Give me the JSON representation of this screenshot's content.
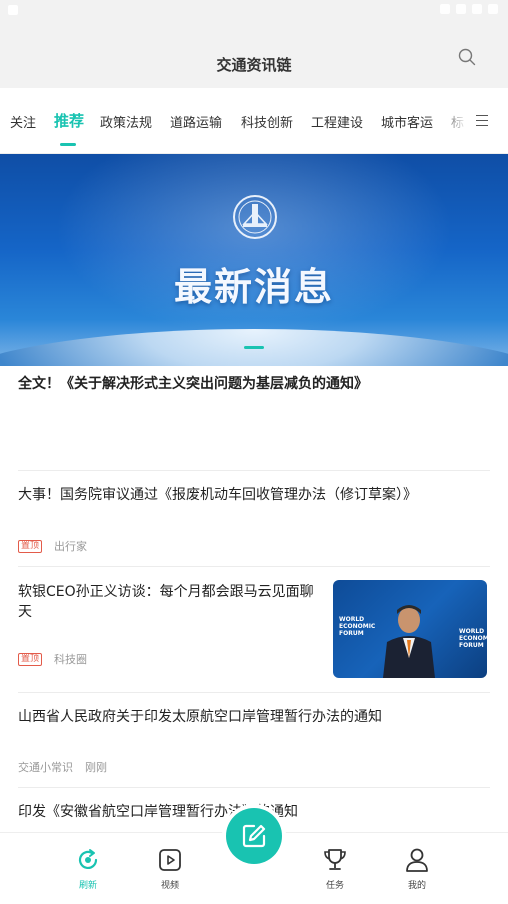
{
  "app": {
    "title": "交通资讯链"
  },
  "tabs": [
    {
      "label": "关注"
    },
    {
      "label": "推荐",
      "active": true
    },
    {
      "label": "政策法规"
    },
    {
      "label": "道路运输"
    },
    {
      "label": "科技创新"
    },
    {
      "label": "工程建设"
    },
    {
      "label": "城市客运"
    },
    {
      "label": "标"
    }
  ],
  "banner": {
    "title": "最新消息"
  },
  "articles": [
    {
      "title": "全文！《关于解决形式主义突出问题为基层减负的通知》"
    },
    {
      "title": "大事！国务院审议通过《报废机动车回收管理办法（修订草案）》",
      "tag": "置顶",
      "source": "出行家"
    },
    {
      "title": "软银CEO孙正义访谈：每个月都会跟马云见面聊天",
      "tag": "置顶",
      "source": "科技圈",
      "thumb_text_left": "WORLD\nECONOMIC\nFORUM",
      "thumb_text_right": "WORLD\nECONOMIC\nFORUM"
    },
    {
      "title": "山西省人民政府关于印发太原航空口岸管理暂行办法的通知",
      "source": "交通小常识",
      "time": "刚刚"
    },
    {
      "title": "印发《安徽省航空口岸管理暂行办法》的通知"
    }
  ],
  "bottom_nav": [
    {
      "label": "刷新",
      "icon": "refresh-icon",
      "active": true
    },
    {
      "label": "视频",
      "icon": "video-icon"
    },
    {
      "label": "",
      "icon": "edit-icon"
    },
    {
      "label": "任务",
      "icon": "trophy-icon"
    },
    {
      "label": "我的",
      "icon": "user-icon"
    }
  ],
  "colors": {
    "accent": "#19c3b1",
    "tag": "#e35b4a",
    "banner": "#1565c7"
  }
}
